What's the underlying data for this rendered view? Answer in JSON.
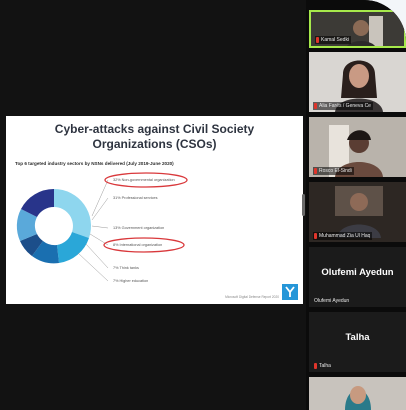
{
  "slide": {
    "title_line1": "Cyber-attacks against Civil Society",
    "title_line2": "Organizations (CSOs)",
    "subtitle": "Top 6 targeted industry sectors by NSNs delivered (July 2019-June 2020)",
    "labels": [
      "32%  Non-governmental organization",
      "31%  Professional services",
      "13%  Government organization",
      "8%  International organization",
      "7%  Think tanks",
      "7%  Higher education"
    ],
    "credit": "Microsoft Digital Defense Report 2020",
    "colors": {
      "slice1": "#8ed6ee",
      "slice2": "#2aa7d8",
      "slice3": "#1a6fb0",
      "slice4": "#1c4e8a",
      "slice5": "#5aa9da",
      "slice6": "#28348a",
      "highlight": "#d9383b"
    }
  },
  "participants": [
    {
      "name": "Kamal Sedki"
    },
    {
      "name": "Alia Farés / Geneva Ce"
    },
    {
      "name": "Rosco El-Sindi"
    },
    {
      "name": "Muhammad Zia Ul Haq"
    },
    {
      "name": "Olufemi Ayedun",
      "display": "Olufemi Ayedun"
    },
    {
      "name": "Talha",
      "display": "Talha"
    },
    {
      "name": ""
    }
  ],
  "accent": "#a6e94b"
}
